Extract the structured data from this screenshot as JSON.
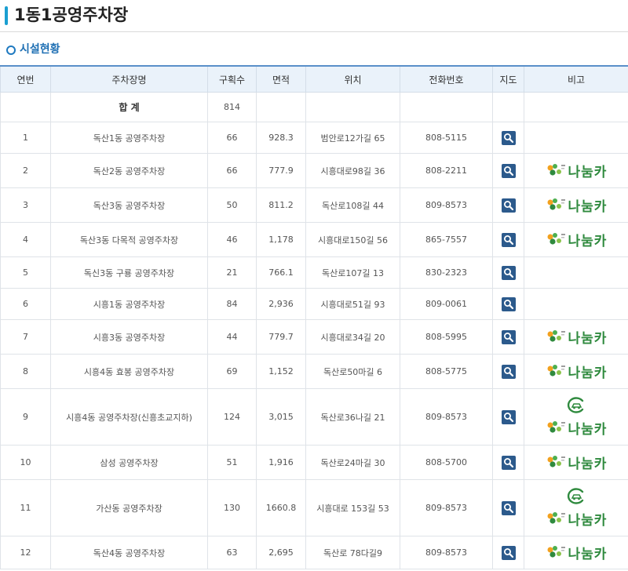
{
  "page": {
    "title": "1동1공영주차장",
    "subtitle": "시설현황"
  },
  "table": {
    "headers": [
      "연번",
      "주차장명",
      "구획수",
      "면적",
      "위치",
      "전화번호",
      "지도",
      "비고"
    ],
    "total": {
      "label": "합 계",
      "slots": "814"
    },
    "rows": [
      {
        "no": "1",
        "name": "독산1동 공영주차장",
        "slots": "66",
        "area": "928.3",
        "loc": "범안로12가길 65",
        "tel": "808-5115",
        "share": false,
        "ecar": false
      },
      {
        "no": "2",
        "name": "독산2동 공영주차장",
        "slots": "66",
        "area": "777.9",
        "loc": "시흥대로98길 36",
        "tel": "808-2211",
        "share": true,
        "ecar": false
      },
      {
        "no": "3",
        "name": "독산3동 공영주차장",
        "slots": "50",
        "area": "811.2",
        "loc": "독산로108길 44",
        "tel": "809-8573",
        "share": true,
        "ecar": false
      },
      {
        "no": "4",
        "name": "독산3동 다목적 공영주차장",
        "slots": "46",
        "area": "1,178",
        "loc": "시흥대로150길 56",
        "tel": "865-7557",
        "share": true,
        "ecar": false
      },
      {
        "no": "5",
        "name": "독신3동 구룡 공영주차장",
        "slots": "21",
        "area": "766.1",
        "loc": "독산로107길 13",
        "tel": "830-2323",
        "share": false,
        "ecar": false
      },
      {
        "no": "6",
        "name": "시흥1동 공영주차장",
        "slots": "84",
        "area": "2,936",
        "loc": "시흥대로51길 93",
        "tel": "809-0061",
        "share": false,
        "ecar": false
      },
      {
        "no": "7",
        "name": "시흥3동 공영주차장",
        "slots": "44",
        "area": "779.7",
        "loc": "시흥대로34길 20",
        "tel": "808-5995",
        "share": true,
        "ecar": false
      },
      {
        "no": "8",
        "name": "시흥4동 효봉 공영주차장",
        "slots": "69",
        "area": "1,152",
        "loc": "독산로50마길 6",
        "tel": "808-5775",
        "share": true,
        "ecar": false
      },
      {
        "no": "9",
        "name": "시흥4동 공영주차장(신흥초교지하)",
        "slots": "124",
        "area": "3,015",
        "loc": "독산로36나길 21",
        "tel": "809-8573",
        "share": true,
        "ecar": true
      },
      {
        "no": "10",
        "name": "삼성 공영주차장",
        "slots": "51",
        "area": "1,916",
        "loc": "독산로24마길 30",
        "tel": "808-5700",
        "share": true,
        "ecar": false
      },
      {
        "no": "11",
        "name": "가산동 공영주차장",
        "slots": "130",
        "area": "1660.8",
        "loc": "시흥대로 153길 53",
        "tel": "809-8573",
        "share": true,
        "ecar": true
      },
      {
        "no": "12",
        "name": "독산4동 공영주차장",
        "slots": "63",
        "area": "2,695",
        "loc": "독산로 78다길9",
        "tel": "809-8573",
        "share": true,
        "ecar": false
      }
    ]
  },
  "icons": {
    "map": "magnifier-icon",
    "share": "nanumcar-logo",
    "ecar": "electric-car-icon"
  },
  "share_logo": {
    "text": "나눔카"
  },
  "colors": {
    "accent": "#1a9fd1",
    "header_bg": "#eaf2fa",
    "map_button": "#2c5a8c",
    "share_green": "#2f8a3e"
  }
}
